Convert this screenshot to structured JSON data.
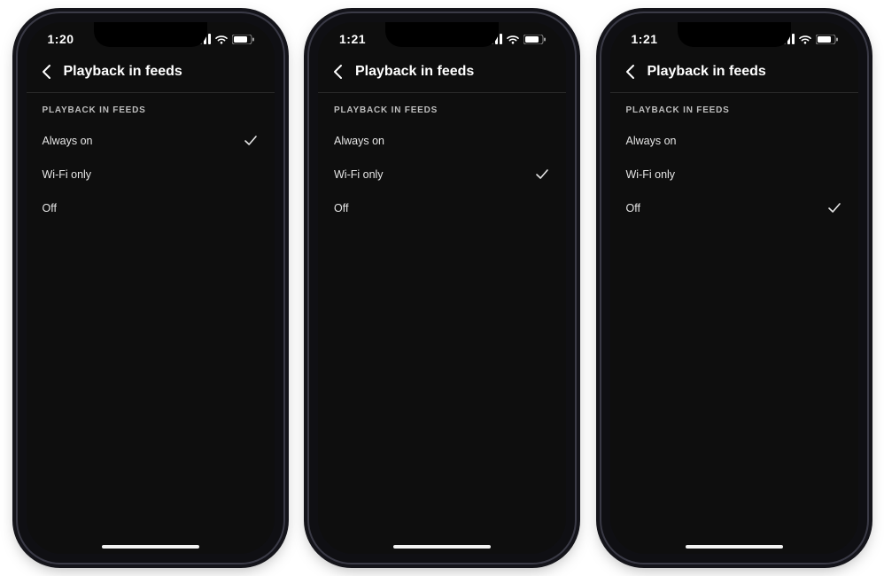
{
  "nav": {
    "title": "Playback in feeds"
  },
  "section": {
    "header": "PLAYBACK IN FEEDS"
  },
  "options": [
    "Always on",
    "Wi-Fi only",
    "Off"
  ],
  "phones": [
    {
      "time": "1:20",
      "selected_index": 0
    },
    {
      "time": "1:21",
      "selected_index": 1
    },
    {
      "time": "1:21",
      "selected_index": 2
    }
  ],
  "colors": {
    "screen_bg": "#0e0e0e",
    "frame": "#0f0f13",
    "text": "#e6e6e6",
    "divider": "#2a2a2a"
  }
}
